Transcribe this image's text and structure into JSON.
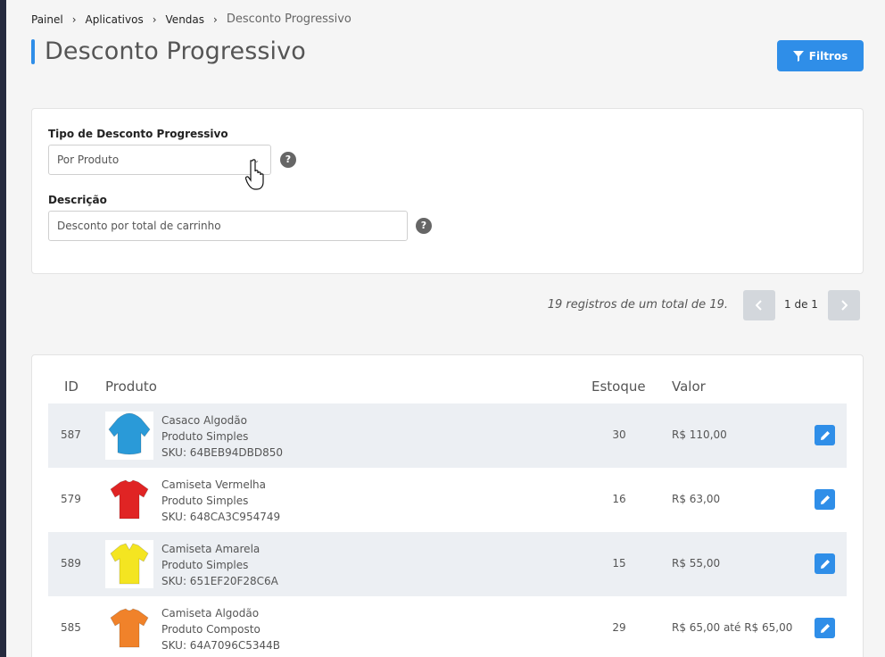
{
  "breadcrumb": {
    "items": [
      "Painel",
      "Aplicativos",
      "Vendas"
    ],
    "current": "Desconto Progressivo"
  },
  "page_title": "Desconto Progressivo",
  "filter_button": {
    "label": "Filtros",
    "icon": "funnel-icon"
  },
  "form": {
    "type_label": "Tipo de Desconto Progressivo",
    "type_value": "Por Produto",
    "description_label": "Descrição",
    "description_value": "Desconto por total de carrinho",
    "help_glyph": "?"
  },
  "pagination": {
    "summary": "19 registros de um total de 19.",
    "page_label": "1 de 1"
  },
  "table": {
    "headers": {
      "id": "ID",
      "product": "Produto",
      "stock": "Estoque",
      "value": "Valor"
    },
    "rows": [
      {
        "id": "587",
        "name": "Casaco Algodão",
        "type": "Produto Simples",
        "sku": "SKU: 64BEB94DBD850",
        "stock": "30",
        "value": "R$ 110,00",
        "thumb_color": "#2a9ad8",
        "thumb_kind": "hoodie"
      },
      {
        "id": "579",
        "name": "Camiseta Vermelha",
        "type": "Produto Simples",
        "sku": "SKU: 648CA3C954749",
        "stock": "16",
        "value": "R$ 63,00",
        "thumb_color": "#e02424",
        "thumb_kind": "tshirt"
      },
      {
        "id": "589",
        "name": "Camiseta Amarela",
        "type": "Produto Simples",
        "sku": "SKU: 651EF20F28C6A",
        "stock": "15",
        "value": "R$ 55,00",
        "thumb_color": "#f4e521",
        "thumb_kind": "polo"
      },
      {
        "id": "585",
        "name": "Camiseta Algodão",
        "type": "Produto Composto",
        "sku": "SKU: 64A7096C5344B",
        "stock": "29",
        "value": "R$ 65,00 até R$ 65,00",
        "thumb_color": "#f0822a",
        "thumb_kind": "tshirt"
      }
    ]
  },
  "colors": {
    "accent": "#2f8ee8",
    "row_alt": "#eceff3",
    "sidebar": "#262b3f"
  }
}
